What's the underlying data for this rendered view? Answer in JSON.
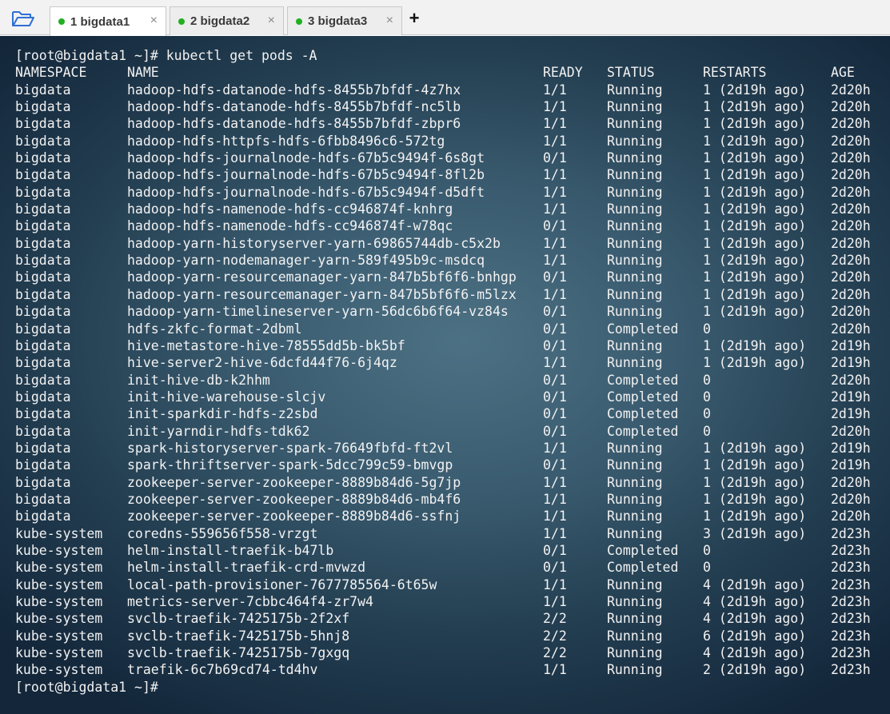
{
  "tabs": [
    {
      "number": "1",
      "label": "bigdata1",
      "active": true
    },
    {
      "number": "2",
      "label": "bigdata2",
      "active": false
    },
    {
      "number": "3",
      "label": "bigdata3",
      "active": false
    }
  ],
  "tab_close_glyph": "×",
  "new_tab_glyph": "+",
  "colors": {
    "status_dot": "#20b020",
    "terminal_text": "#f2f2f2",
    "folder_icon": "#2f6fd6"
  },
  "terminal": {
    "command_line": "[root@bigdata1 ~]# kubectl get pods -A",
    "prompt_line": "[root@bigdata1 ~]#",
    "headers": {
      "namespace": "NAMESPACE",
      "name": "NAME",
      "ready": "READY",
      "status": "STATUS",
      "restarts": "RESTARTS",
      "age": "AGE"
    },
    "rows": [
      {
        "namespace": "bigdata",
        "name": "hadoop-hdfs-datanode-hdfs-8455b7bfdf-4z7hx",
        "ready": "1/1",
        "status": "Running",
        "restarts": "1 (2d19h ago)",
        "age": "2d20h"
      },
      {
        "namespace": "bigdata",
        "name": "hadoop-hdfs-datanode-hdfs-8455b7bfdf-nc5lb",
        "ready": "1/1",
        "status": "Running",
        "restarts": "1 (2d19h ago)",
        "age": "2d20h"
      },
      {
        "namespace": "bigdata",
        "name": "hadoop-hdfs-datanode-hdfs-8455b7bfdf-zbpr6",
        "ready": "1/1",
        "status": "Running",
        "restarts": "1 (2d19h ago)",
        "age": "2d20h"
      },
      {
        "namespace": "bigdata",
        "name": "hadoop-hdfs-httpfs-hdfs-6fbb8496c6-572tg",
        "ready": "1/1",
        "status": "Running",
        "restarts": "1 (2d19h ago)",
        "age": "2d20h"
      },
      {
        "namespace": "bigdata",
        "name": "hadoop-hdfs-journalnode-hdfs-67b5c9494f-6s8gt",
        "ready": "0/1",
        "status": "Running",
        "restarts": "1 (2d19h ago)",
        "age": "2d20h"
      },
      {
        "namespace": "bigdata",
        "name": "hadoop-hdfs-journalnode-hdfs-67b5c9494f-8fl2b",
        "ready": "1/1",
        "status": "Running",
        "restarts": "1 (2d19h ago)",
        "age": "2d20h"
      },
      {
        "namespace": "bigdata",
        "name": "hadoop-hdfs-journalnode-hdfs-67b5c9494f-d5dft",
        "ready": "1/1",
        "status": "Running",
        "restarts": "1 (2d19h ago)",
        "age": "2d20h"
      },
      {
        "namespace": "bigdata",
        "name": "hadoop-hdfs-namenode-hdfs-cc946874f-knhrg",
        "ready": "1/1",
        "status": "Running",
        "restarts": "1 (2d19h ago)",
        "age": "2d20h"
      },
      {
        "namespace": "bigdata",
        "name": "hadoop-hdfs-namenode-hdfs-cc946874f-w78qc",
        "ready": "0/1",
        "status": "Running",
        "restarts": "1 (2d19h ago)",
        "age": "2d20h"
      },
      {
        "namespace": "bigdata",
        "name": "hadoop-yarn-historyserver-yarn-69865744db-c5x2b",
        "ready": "1/1",
        "status": "Running",
        "restarts": "1 (2d19h ago)",
        "age": "2d20h"
      },
      {
        "namespace": "bigdata",
        "name": "hadoop-yarn-nodemanager-yarn-589f495b9c-msdcq",
        "ready": "1/1",
        "status": "Running",
        "restarts": "1 (2d19h ago)",
        "age": "2d20h"
      },
      {
        "namespace": "bigdata",
        "name": "hadoop-yarn-resourcemanager-yarn-847b5bf6f6-bnhgp",
        "ready": "0/1",
        "status": "Running",
        "restarts": "1 (2d19h ago)",
        "age": "2d20h"
      },
      {
        "namespace": "bigdata",
        "name": "hadoop-yarn-resourcemanager-yarn-847b5bf6f6-m5lzx",
        "ready": "1/1",
        "status": "Running",
        "restarts": "1 (2d19h ago)",
        "age": "2d20h"
      },
      {
        "namespace": "bigdata",
        "name": "hadoop-yarn-timelineserver-yarn-56dc6b6f64-vz84s",
        "ready": "0/1",
        "status": "Running",
        "restarts": "1 (2d19h ago)",
        "age": "2d20h"
      },
      {
        "namespace": "bigdata",
        "name": "hdfs-zkfc-format-2dbml",
        "ready": "0/1",
        "status": "Completed",
        "restarts": "0",
        "age": "2d20h"
      },
      {
        "namespace": "bigdata",
        "name": "hive-metastore-hive-78555dd5b-bk5bf",
        "ready": "0/1",
        "status": "Running",
        "restarts": "1 (2d19h ago)",
        "age": "2d19h"
      },
      {
        "namespace": "bigdata",
        "name": "hive-server2-hive-6dcfd44f76-6j4qz",
        "ready": "1/1",
        "status": "Running",
        "restarts": "1 (2d19h ago)",
        "age": "2d19h"
      },
      {
        "namespace": "bigdata",
        "name": "init-hive-db-k2hhm",
        "ready": "0/1",
        "status": "Completed",
        "restarts": "0",
        "age": "2d20h"
      },
      {
        "namespace": "bigdata",
        "name": "init-hive-warehouse-slcjv",
        "ready": "0/1",
        "status": "Completed",
        "restarts": "0",
        "age": "2d19h"
      },
      {
        "namespace": "bigdata",
        "name": "init-sparkdir-hdfs-z2sbd",
        "ready": "0/1",
        "status": "Completed",
        "restarts": "0",
        "age": "2d19h"
      },
      {
        "namespace": "bigdata",
        "name": "init-yarndir-hdfs-tdk62",
        "ready": "0/1",
        "status": "Completed",
        "restarts": "0",
        "age": "2d20h"
      },
      {
        "namespace": "bigdata",
        "name": "spark-historyserver-spark-76649fbfd-ft2vl",
        "ready": "1/1",
        "status": "Running",
        "restarts": "1 (2d19h ago)",
        "age": "2d19h"
      },
      {
        "namespace": "bigdata",
        "name": "spark-thriftserver-spark-5dcc799c59-bmvgp",
        "ready": "0/1",
        "status": "Running",
        "restarts": "1 (2d19h ago)",
        "age": "2d19h"
      },
      {
        "namespace": "bigdata",
        "name": "zookeeper-server-zookeeper-8889b84d6-5g7jp",
        "ready": "1/1",
        "status": "Running",
        "restarts": "1 (2d19h ago)",
        "age": "2d20h"
      },
      {
        "namespace": "bigdata",
        "name": "zookeeper-server-zookeeper-8889b84d6-mb4f6",
        "ready": "1/1",
        "status": "Running",
        "restarts": "1 (2d19h ago)",
        "age": "2d20h"
      },
      {
        "namespace": "bigdata",
        "name": "zookeeper-server-zookeeper-8889b84d6-ssfnj",
        "ready": "1/1",
        "status": "Running",
        "restarts": "1 (2d19h ago)",
        "age": "2d20h"
      },
      {
        "namespace": "kube-system",
        "name": "coredns-559656f558-vrzgt",
        "ready": "1/1",
        "status": "Running",
        "restarts": "3 (2d19h ago)",
        "age": "2d23h"
      },
      {
        "namespace": "kube-system",
        "name": "helm-install-traefik-b47lb",
        "ready": "0/1",
        "status": "Completed",
        "restarts": "0",
        "age": "2d23h"
      },
      {
        "namespace": "kube-system",
        "name": "helm-install-traefik-crd-mvwzd",
        "ready": "0/1",
        "status": "Completed",
        "restarts": "0",
        "age": "2d23h"
      },
      {
        "namespace": "kube-system",
        "name": "local-path-provisioner-7677785564-6t65w",
        "ready": "1/1",
        "status": "Running",
        "restarts": "4 (2d19h ago)",
        "age": "2d23h"
      },
      {
        "namespace": "kube-system",
        "name": "metrics-server-7cbbc464f4-zr7w4",
        "ready": "1/1",
        "status": "Running",
        "restarts": "4 (2d19h ago)",
        "age": "2d23h"
      },
      {
        "namespace": "kube-system",
        "name": "svclb-traefik-7425175b-2f2xf",
        "ready": "2/2",
        "status": "Running",
        "restarts": "4 (2d19h ago)",
        "age": "2d23h"
      },
      {
        "namespace": "kube-system",
        "name": "svclb-traefik-7425175b-5hnj8",
        "ready": "2/2",
        "status": "Running",
        "restarts": "6 (2d19h ago)",
        "age": "2d23h"
      },
      {
        "namespace": "kube-system",
        "name": "svclb-traefik-7425175b-7gxgq",
        "ready": "2/2",
        "status": "Running",
        "restarts": "4 (2d19h ago)",
        "age": "2d23h"
      },
      {
        "namespace": "kube-system",
        "name": "traefik-6c7b69cd74-td4hv",
        "ready": "1/1",
        "status": "Running",
        "restarts": "2 (2d19h ago)",
        "age": "2d23h"
      }
    ]
  }
}
